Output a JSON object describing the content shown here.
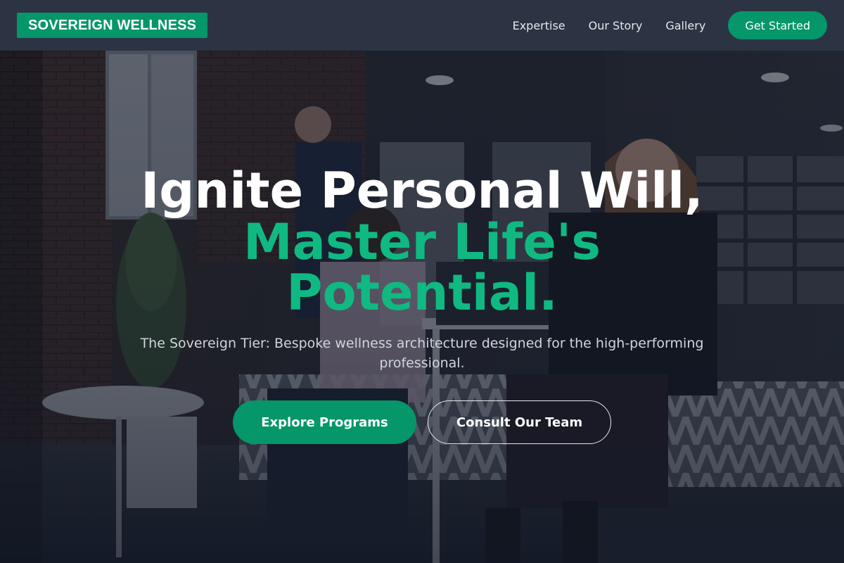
{
  "brand": {
    "name": "SOVEREIGN WELLNESS"
  },
  "nav": {
    "links": [
      {
        "label": "Expertise"
      },
      {
        "label": "Our Story"
      },
      {
        "label": "Gallery"
      }
    ],
    "cta_label": "Get Started"
  },
  "hero": {
    "headline_line1": "Ignite Personal Will,",
    "headline_line2": "Master Life's",
    "headline_line3": "Potential.",
    "subtitle": "The Sovereign Tier: Bespoke wellness architecture designed for the high-performing professional.",
    "primary_button": "Explore Programs",
    "secondary_button": "Consult Our Team",
    "background_image": "office-lounge-photo"
  },
  "colors": {
    "accent": "#10b981",
    "brand": "#059669",
    "navbar": "#2c3444",
    "text_light": "#d1d5db"
  }
}
